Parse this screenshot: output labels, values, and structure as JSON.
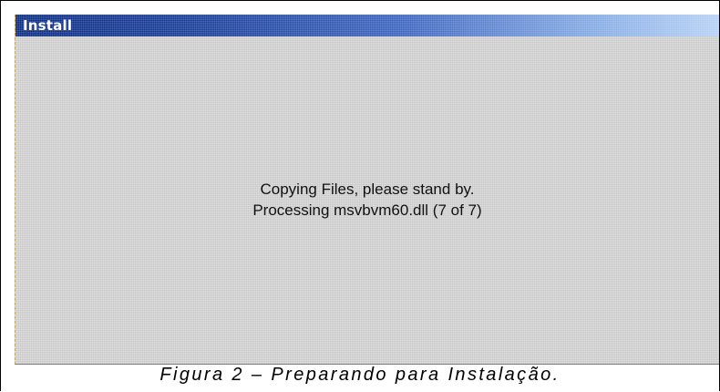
{
  "window": {
    "title": "Install"
  },
  "status": {
    "line1": "Copying Files, please stand by.",
    "line2": "Processing msvbvm60.dll (7 of 7)"
  },
  "caption": "Figura 2 – Preparando para Instalação."
}
